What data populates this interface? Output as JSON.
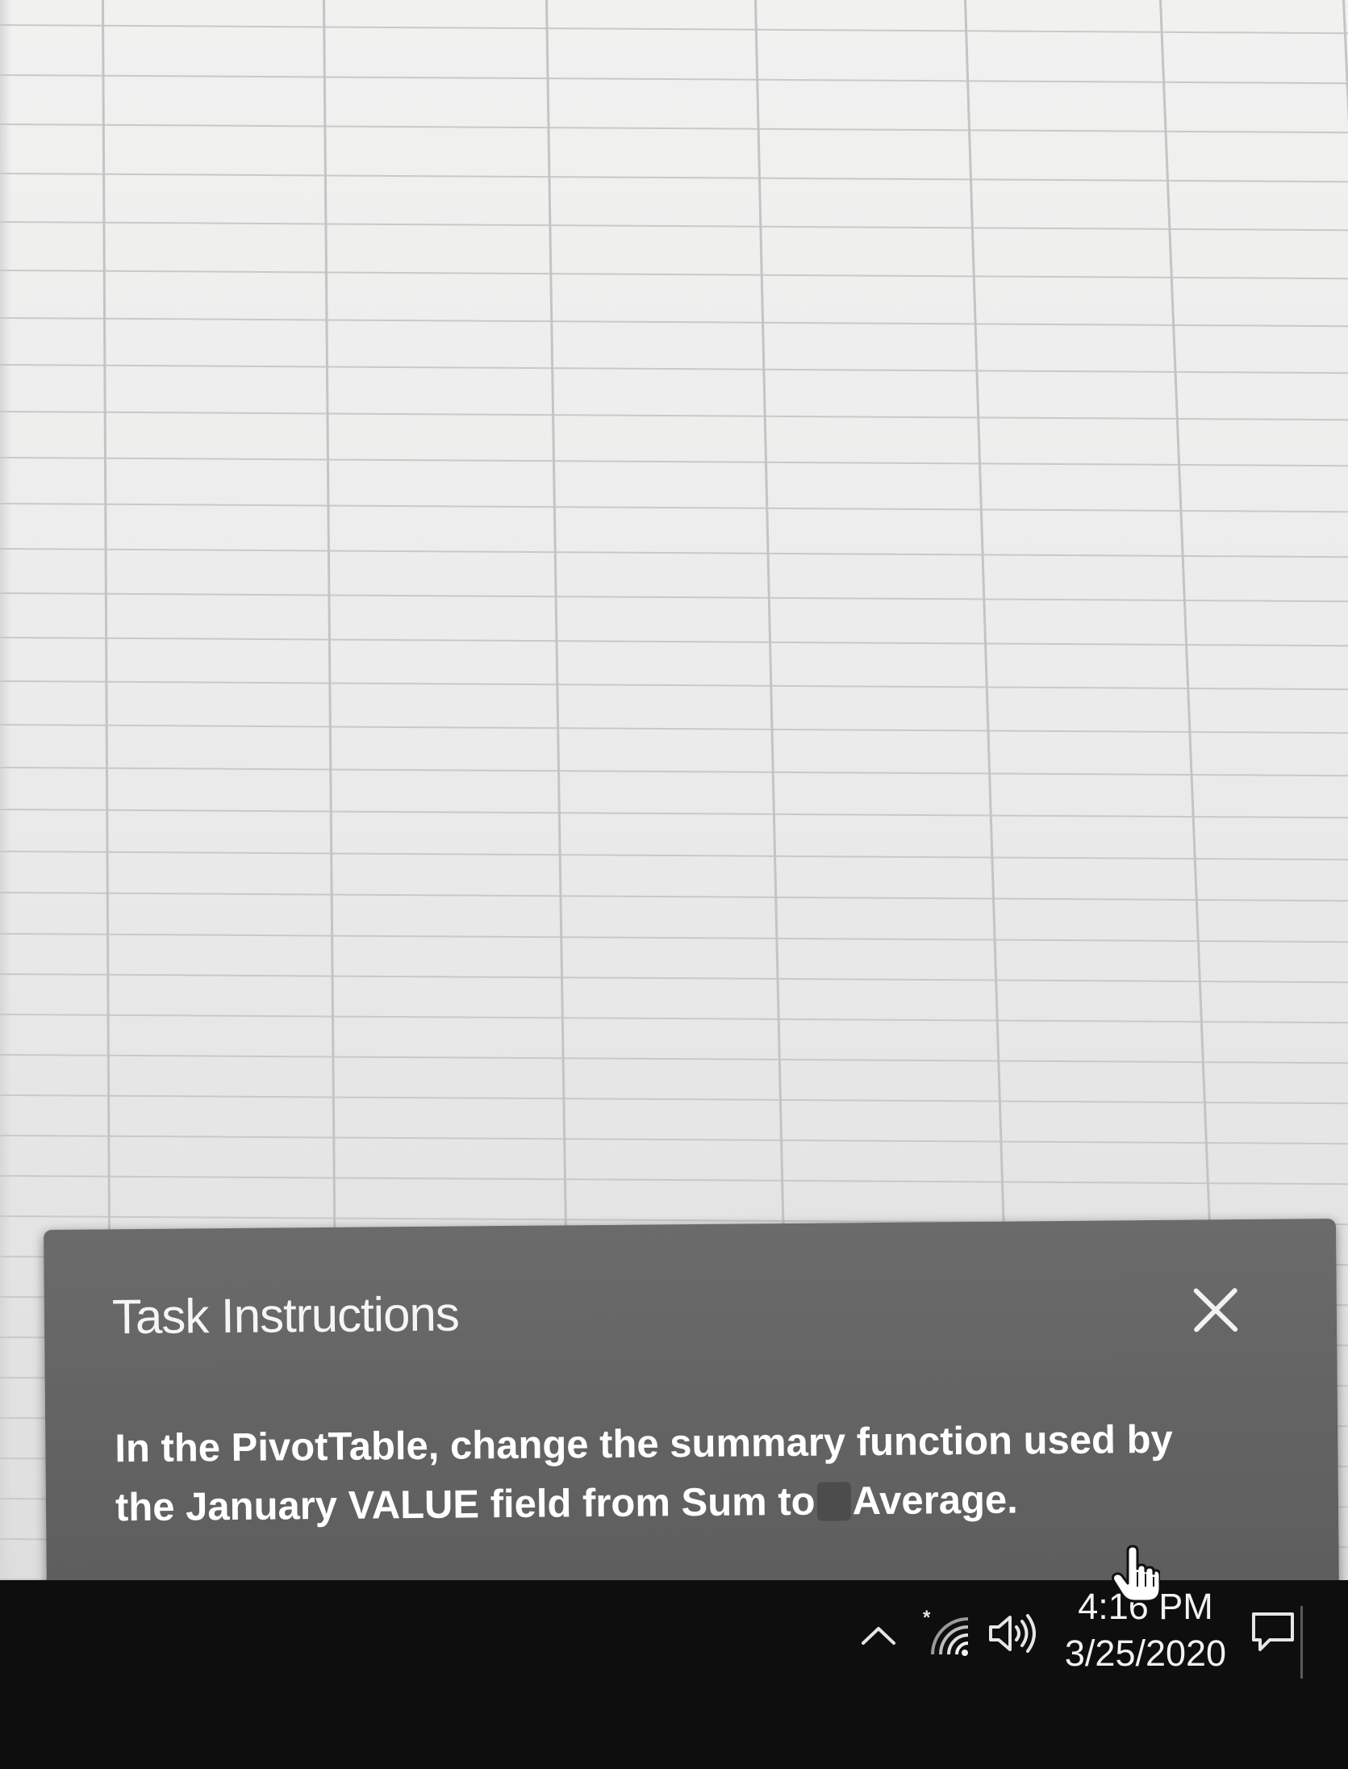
{
  "task_panel": {
    "title": "Task Instructions",
    "body_line_1": "In the PivotTable, change the summary function used by",
    "body_line_2_start": "the January VALUE field from Sum to",
    "body_line_2_end": "Average."
  },
  "taskbar": {
    "time": "4:16 PM",
    "date": "3/25/2020",
    "tray_icons": [
      "chevron-up-icon",
      "wifi-icon",
      "speaker-icon",
      "notification-icon"
    ]
  },
  "colors": {
    "panel_background": "#646464",
    "panel_text": "#ffffff",
    "taskbar_background": "#0e0e0f",
    "grid_line": "#c9c9c9"
  }
}
